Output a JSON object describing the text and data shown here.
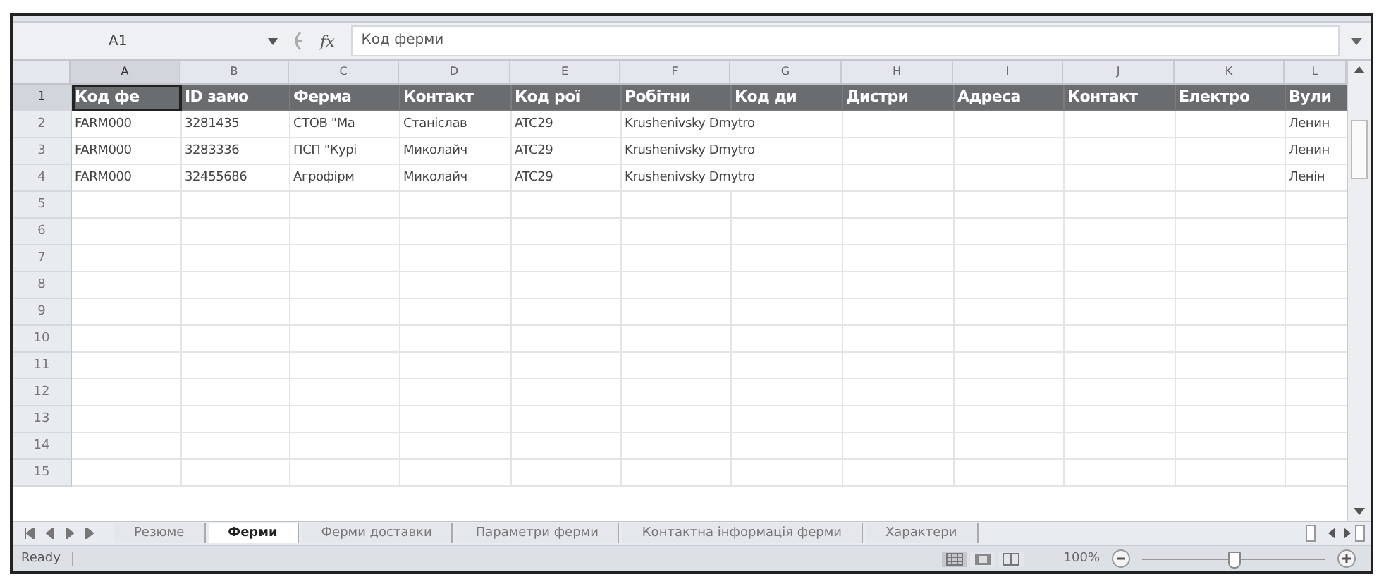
{
  "formula_bar": {
    "name_box": "A1",
    "formula": "Код ферми",
    "function_label": "fx"
  },
  "columns": [
    {
      "letter": "A",
      "selected": true
    },
    {
      "letter": "B",
      "selected": false
    },
    {
      "letter": "C",
      "selected": false
    },
    {
      "letter": "D",
      "selected": false
    },
    {
      "letter": "E",
      "selected": false
    },
    {
      "letter": "F",
      "selected": false
    },
    {
      "letter": "G",
      "selected": false
    },
    {
      "letter": "H",
      "selected": false
    },
    {
      "letter": "I",
      "selected": false
    },
    {
      "letter": "J",
      "selected": false
    },
    {
      "letter": "K",
      "selected": false
    },
    {
      "letter": "L",
      "selected": false
    }
  ],
  "rows": [
    {
      "number": "1",
      "selected": true,
      "header": true,
      "cells": {
        "A": "Код фе",
        "B": "ID замо",
        "C": "Ферма",
        "D": "Контакт",
        "E": "Код рої",
        "F": "Робітни",
        "G": "Код ди",
        "H": "Дистри",
        "I": "Адреса",
        "J": "Контакт",
        "K": "Електро",
        "L": "Вули"
      }
    },
    {
      "number": "2",
      "selected": false,
      "header": false,
      "cells": {
        "A": "FARM000",
        "B": "3281435",
        "C": "СТОВ \"Ма",
        "D": "Станіслав",
        "E": "ATC29",
        "F": "Krushenivsky Dmytro",
        "L": "Ленин"
      }
    },
    {
      "number": "3",
      "selected": false,
      "header": false,
      "cells": {
        "A": "FARM000",
        "B": "3283336",
        "C": "ПСП \"Курі",
        "D": "Миколайч",
        "E": "ATC29",
        "F": "Krushenivsky Dmytro",
        "L": "Ленин"
      }
    },
    {
      "number": "4",
      "selected": false,
      "header": false,
      "cells": {
        "A": "FARM000",
        "B": "32455686",
        "C": "Агрофірм",
        "D": "Миколайч",
        "E": "ATC29",
        "F": "Krushenivsky Dmytro",
        "L": "Ленін"
      }
    },
    {
      "number": "5",
      "selected": false,
      "header": false
    },
    {
      "number": "6",
      "selected": false,
      "header": false
    },
    {
      "number": "7",
      "selected": false,
      "header": false
    },
    {
      "number": "8",
      "selected": false,
      "header": false
    },
    {
      "number": "9",
      "selected": false,
      "header": false
    },
    {
      "number": "10",
      "selected": false,
      "header": false
    },
    {
      "number": "11",
      "selected": false,
      "header": false
    },
    {
      "number": "12",
      "selected": false,
      "header": false
    },
    {
      "number": "13",
      "selected": false,
      "header": false
    },
    {
      "number": "14",
      "selected": false,
      "header": false
    },
    {
      "number": "15",
      "selected": false,
      "header": false
    }
  ],
  "sheet_tabs": [
    {
      "label": "Резюме",
      "selected": false
    },
    {
      "label": "Ферми",
      "selected": true
    },
    {
      "label": "Ферми доставки",
      "selected": false
    },
    {
      "label": "Параметри ферми",
      "selected": false
    },
    {
      "label": "Контактна інформація ферми",
      "selected": false
    },
    {
      "label": "Характери",
      "selected": false
    }
  ],
  "status_bar": {
    "status": "Ready",
    "views": [
      {
        "kind": "normal",
        "selected": true
      },
      {
        "kind": "layout",
        "selected": false
      },
      {
        "kind": "break",
        "selected": false
      }
    ],
    "zoom": "100%",
    "zoom_slider": {
      "level": 0.5
    }
  }
}
